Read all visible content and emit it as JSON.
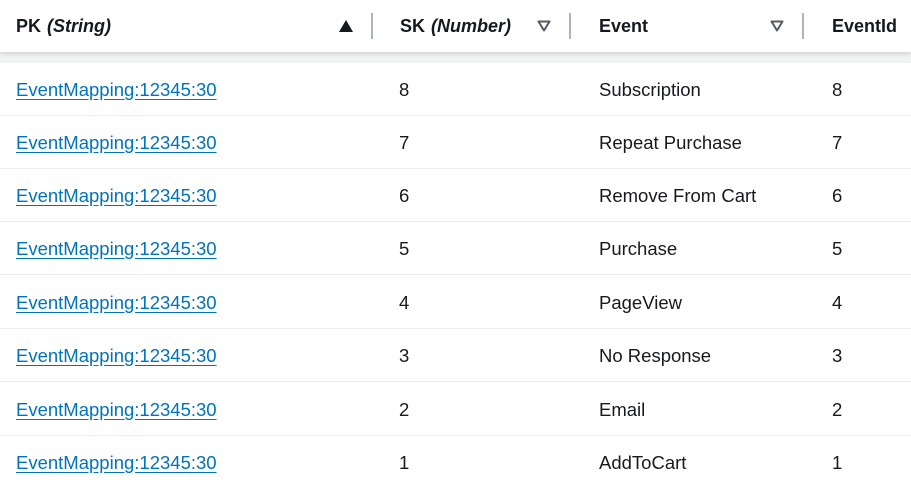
{
  "columns": [
    {
      "key": "pk",
      "label": "PK",
      "type": "(String)",
      "sort": "ascending"
    },
    {
      "key": "sk",
      "label": "SK",
      "type": "(Number)",
      "sort": "descending"
    },
    {
      "key": "event",
      "label": "Event",
      "type": "",
      "sort": "descending"
    },
    {
      "key": "event_id",
      "label": "EventId",
      "type": "",
      "sort": ""
    }
  ],
  "rows": [
    {
      "pk": "EventMapping:12345:30",
      "sk": "8",
      "event": "Subscription",
      "event_id": "8"
    },
    {
      "pk": "EventMapping:12345:30",
      "sk": "7",
      "event": "Repeat Purchase",
      "event_id": "7"
    },
    {
      "pk": "EventMapping:12345:30",
      "sk": "6",
      "event": "Remove From Cart",
      "event_id": "6"
    },
    {
      "pk": "EventMapping:12345:30",
      "sk": "5",
      "event": "Purchase",
      "event_id": "5"
    },
    {
      "pk": "EventMapping:12345:30",
      "sk": "4",
      "event": "PageView",
      "event_id": "4"
    },
    {
      "pk": "EventMapping:12345:30",
      "sk": "3",
      "event": "No Response",
      "event_id": "3"
    },
    {
      "pk": "EventMapping:12345:30",
      "sk": "2",
      "event": "Email",
      "event_id": "2"
    },
    {
      "pk": "EventMapping:12345:30",
      "sk": "1",
      "event": "AddToCart",
      "event_id": "1"
    }
  ],
  "colors": {
    "link": "#0073bb",
    "text": "#16191f",
    "divider": "#aab7b8"
  },
  "icons": {
    "sort_ascending": "triangle-up-filled-icon",
    "sort_descending": "triangle-down-outline-icon"
  }
}
